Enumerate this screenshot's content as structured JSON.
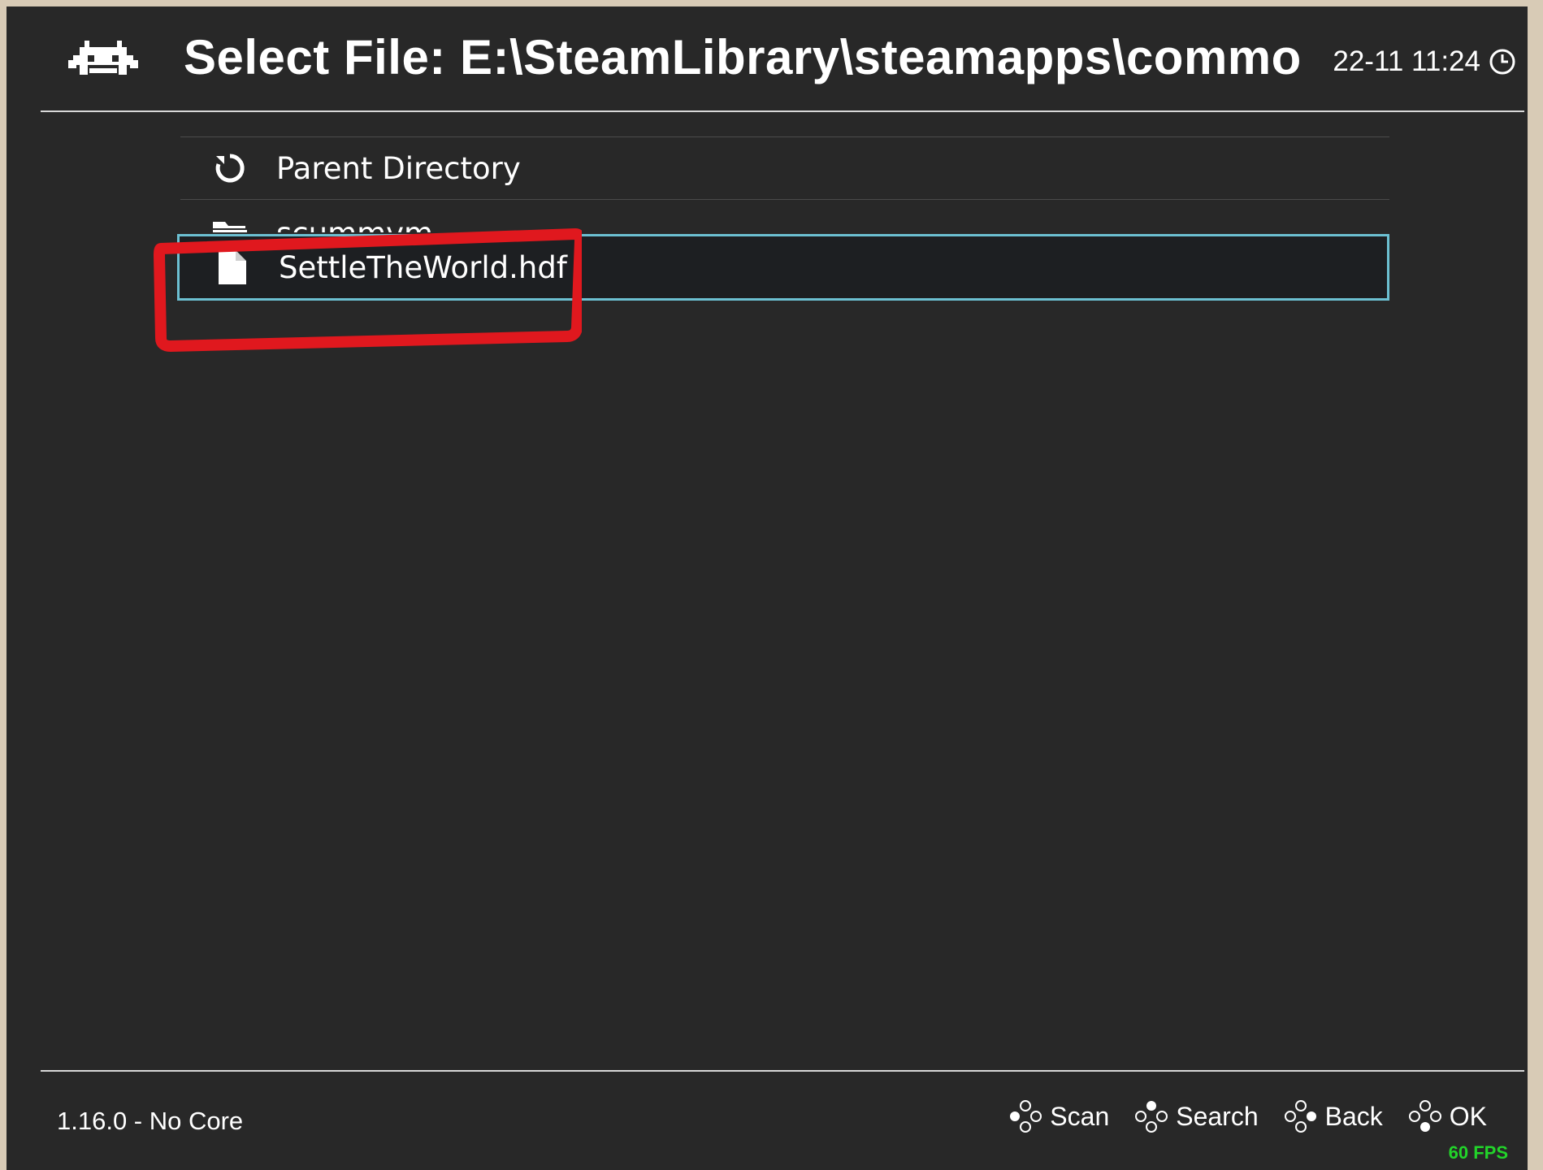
{
  "header": {
    "title": "Select File: E:\\SteamLibrary\\steamapps\\commo",
    "clock": "22-11 11:24",
    "logo_icon": "retroarch-invader-logo",
    "clock_icon": "clock-icon"
  },
  "list": {
    "items": [
      {
        "label": "Parent Directory",
        "icon": "refresh-icon"
      },
      {
        "label": "scummvm",
        "icon": "folder-icon"
      },
      {
        "label": "SettleTheWorld.hdf",
        "icon": "file-icon",
        "selected": true
      }
    ]
  },
  "footer": {
    "version": "1.16.0 - No Core",
    "actions": [
      {
        "label": "Scan",
        "icon": "gamepad-left-button-icon"
      },
      {
        "label": "Search",
        "icon": "gamepad-top-button-icon"
      },
      {
        "label": "Back",
        "icon": "gamepad-right-button-icon"
      },
      {
        "label": "OK",
        "icon": "gamepad-bottom-button-icon"
      }
    ],
    "fps": "60 FPS"
  },
  "colors": {
    "background": "#282828",
    "selection_border": "#6cc0d2",
    "selection_fill": "#1d1f22",
    "annotation": "#e0181e",
    "fps": "#22d42a"
  }
}
